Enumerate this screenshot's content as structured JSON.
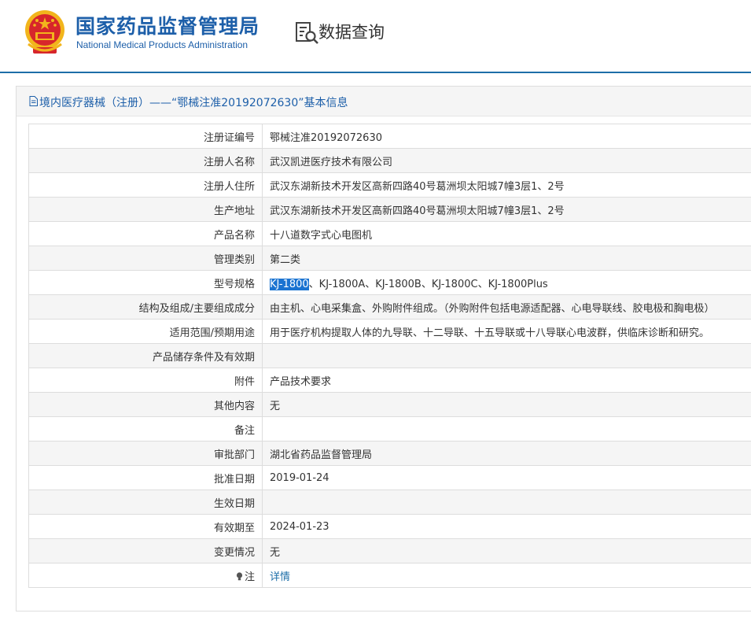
{
  "header": {
    "org_name_cn": "国家药品监督管理局",
    "org_name_en": "National Medical Products Administration",
    "query_title": "数据查询",
    "emblem_icon": "national-emblem-icon",
    "query_icon": "data-search-icon",
    "brand_color": "#1d5fa9",
    "emblem_red": "#d7262b",
    "emblem_gold": "#f2b51c"
  },
  "panel": {
    "doc_icon": "document-icon",
    "title": "境内医疗器械（注册）——“鄂械注准20192072630”基本信息"
  },
  "table": {
    "rows": [
      {
        "label": "注册证编号",
        "value": "鄂械注准20192072630"
      },
      {
        "label": "注册人名称",
        "value": "武汉凯进医疗技术有限公司"
      },
      {
        "label": "注册人住所",
        "value": "武汉东湖新技术开发区高新四路40号葛洲坝太阳城7幢3层1、2号"
      },
      {
        "label": "生产地址",
        "value": "武汉东湖新技术开发区高新四路40号葛洲坝太阳城7幢3层1、2号"
      },
      {
        "label": "产品名称",
        "value": "十八道数字式心电图机"
      },
      {
        "label": "管理类别",
        "value": "第二类"
      },
      {
        "label": "型号规格",
        "value_highlighted": "KJ-1800",
        "value_rest": "、KJ-1800A、KJ-1800B、KJ-1800C、KJ-1800Plus"
      },
      {
        "label": "结构及组成/主要组成成分",
        "value": "由主机、心电采集盒、外购附件组成。（外购附件包括电源适配器、心电导联线、胶电极和胸电极）"
      },
      {
        "label": "适用范围/预期用途",
        "value": "用于医疗机构提取人体的九导联、十二导联、十五导联或十八导联心电波群，供临床诊断和研究。"
      },
      {
        "label": "产品储存条件及有效期",
        "value": ""
      },
      {
        "label": "附件",
        "value": "产品技术要求"
      },
      {
        "label": "其他内容",
        "value": "无"
      },
      {
        "label": "备注",
        "value": ""
      },
      {
        "label": "审批部门",
        "value": "湖北省药品监督管理局"
      },
      {
        "label": "批准日期",
        "value": "2019-01-24"
      },
      {
        "label": "生效日期",
        "value": ""
      },
      {
        "label": "有效期至",
        "value": "2024-01-23"
      },
      {
        "label": "变更情况",
        "value": "无"
      },
      {
        "label": "注",
        "icon": "lightbulb-icon",
        "link_text": "详情"
      }
    ]
  }
}
